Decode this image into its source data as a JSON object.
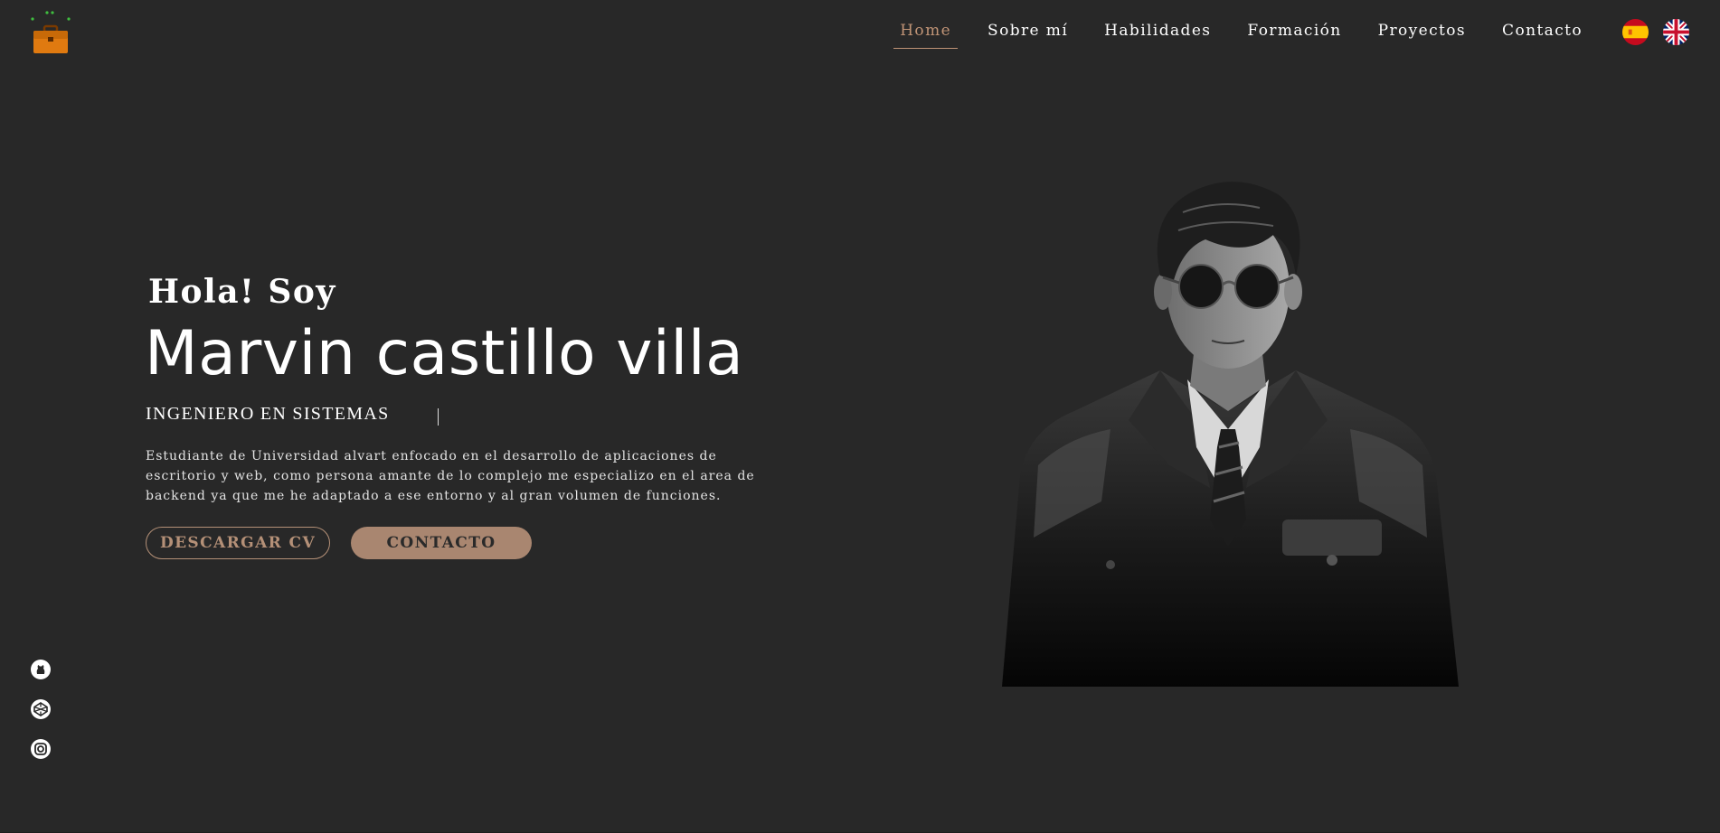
{
  "brand": {
    "logo_icon": "briefcase-icon"
  },
  "nav": {
    "items": [
      {
        "label": "Home",
        "active": true
      },
      {
        "label": "Sobre mí"
      },
      {
        "label": "Habilidades"
      },
      {
        "label": "Formación"
      },
      {
        "label": "Proyectos"
      },
      {
        "label": "Contacto"
      }
    ]
  },
  "languages": [
    {
      "icon": "spain-flag-icon"
    },
    {
      "icon": "uk-flag-icon"
    }
  ],
  "hero": {
    "greeting": "Hola! Soy",
    "name": "Marvin castillo villa",
    "role": "INGENIERO EN SISTEMAS",
    "description": "Estudiante de Universidad alvart enfocado en el desarrollo de aplicaciones de escritorio y web, como persona amante de lo complejo me especializo en el area de backend ya que me he adaptado a ese entorno y al gran volumen de funciones.",
    "download_cv": "DESCARGAR CV",
    "contact": "CONTACTO",
    "portrait_icon": "portrait-illustration"
  },
  "social": [
    {
      "icon": "github-icon"
    },
    {
      "icon": "codepen-icon"
    },
    {
      "icon": "instagram-icon"
    }
  ],
  "colors": {
    "background": "#282828",
    "accent": "#c09476",
    "button_fill": "#a98670"
  }
}
